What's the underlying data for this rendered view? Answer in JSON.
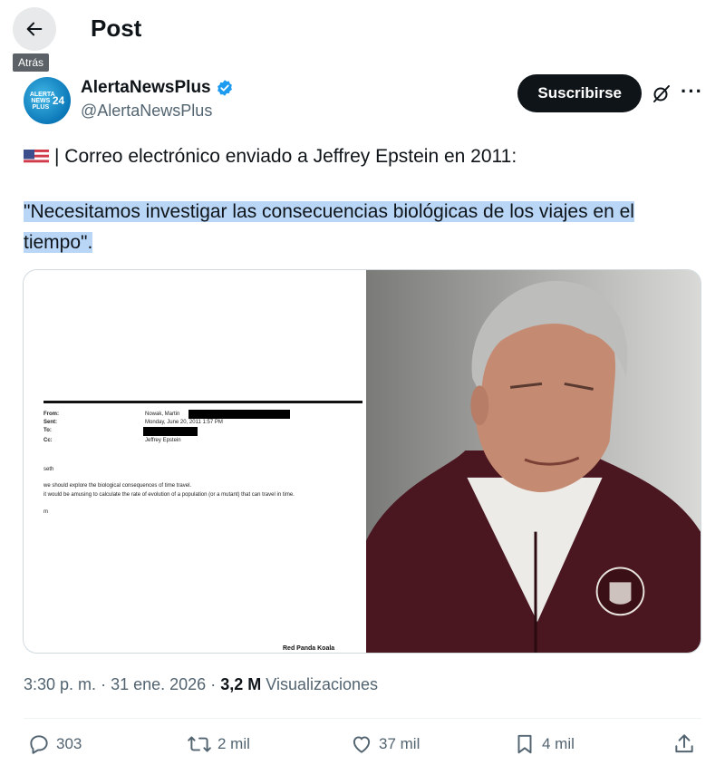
{
  "header": {
    "title": "Post",
    "back_tooltip": "Atrás"
  },
  "author": {
    "display_name": "AlertaNewsPlus",
    "handle": "@AlertaNewsPlus",
    "avatar_text": "ALERTA NEWS PLUS",
    "avatar_number": "24",
    "subscribe_label": "Suscribirse"
  },
  "post": {
    "line1": "| Correo electrónico enviado a Jeffrey Epstein en 2011:",
    "quote": "\"Necesitamos investigar las consecuencias biológicas de los viajes en el tiempo\"."
  },
  "media": {
    "email": {
      "from_label": "From:",
      "from_value": "Nowak, Martin",
      "sent_label": "Sent:",
      "sent_value": "Monday, June 20, 2011 1:57 PM",
      "to_label": "To:",
      "cc_label": "Cc:",
      "cc_value": "Jeffrey Epstein",
      "greeting": "seth",
      "body1": "we should explore the biological consequences of time travel.",
      "body2": "it would be amusing to calculate the rate of evolution of a population (or a mutant) that can travel in time.",
      "sign": "m",
      "watermark": "Red Panda Koala"
    }
  },
  "meta": {
    "time": "3:30 p. m.",
    "sep1": "·",
    "date": "31 ene. 2026",
    "sep2": "·",
    "views_count": "3,2 M",
    "views_label": "Visualizaciones"
  },
  "actions": {
    "replies": "303",
    "reposts": "2 mil",
    "likes": "37 mil",
    "bookmarks": "4 mil"
  },
  "colors": {
    "verified": "#1d9bf0",
    "highlight": "#b9d6f7",
    "muted": "#536471"
  }
}
